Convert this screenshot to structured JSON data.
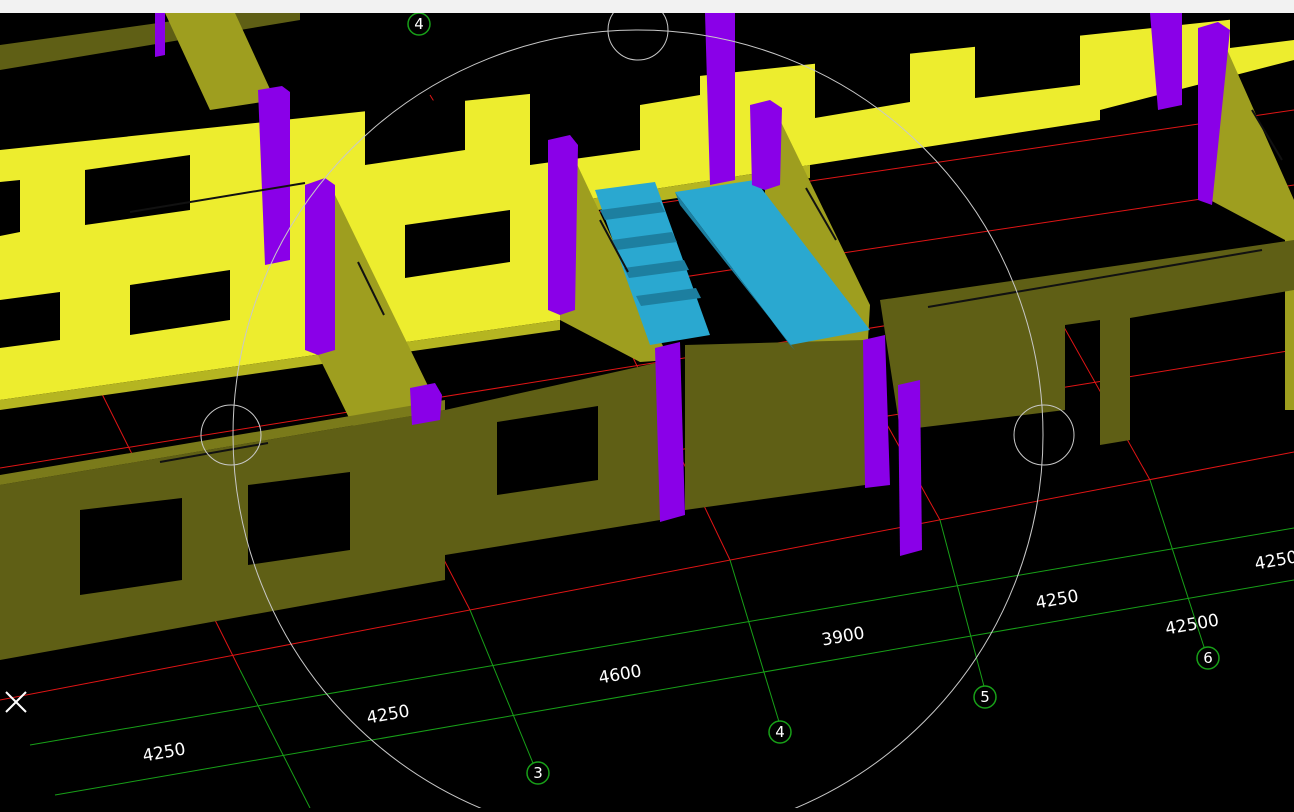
{
  "colors": {
    "background": "#000000",
    "grid_red": "#e01515",
    "grid_green": "#18a018",
    "wall_top_yellow": "#eded2e",
    "wall_face_olive": "#5f5f15",
    "wall_side_olive": "#9e9e1f",
    "column_purple": "#8a00e8",
    "stair_cyan": "#2aa8d0"
  },
  "axis_markers": [
    "4",
    "3",
    "4",
    "5",
    "6"
  ],
  "dimensions": {
    "inner_row": [
      "4250",
      "4250",
      "4600",
      "3900",
      "4250",
      "4250"
    ],
    "total": "42500"
  },
  "icons": {
    "ucs": "ucs-cross-icon",
    "orbit": "orbit-circle-icon"
  }
}
